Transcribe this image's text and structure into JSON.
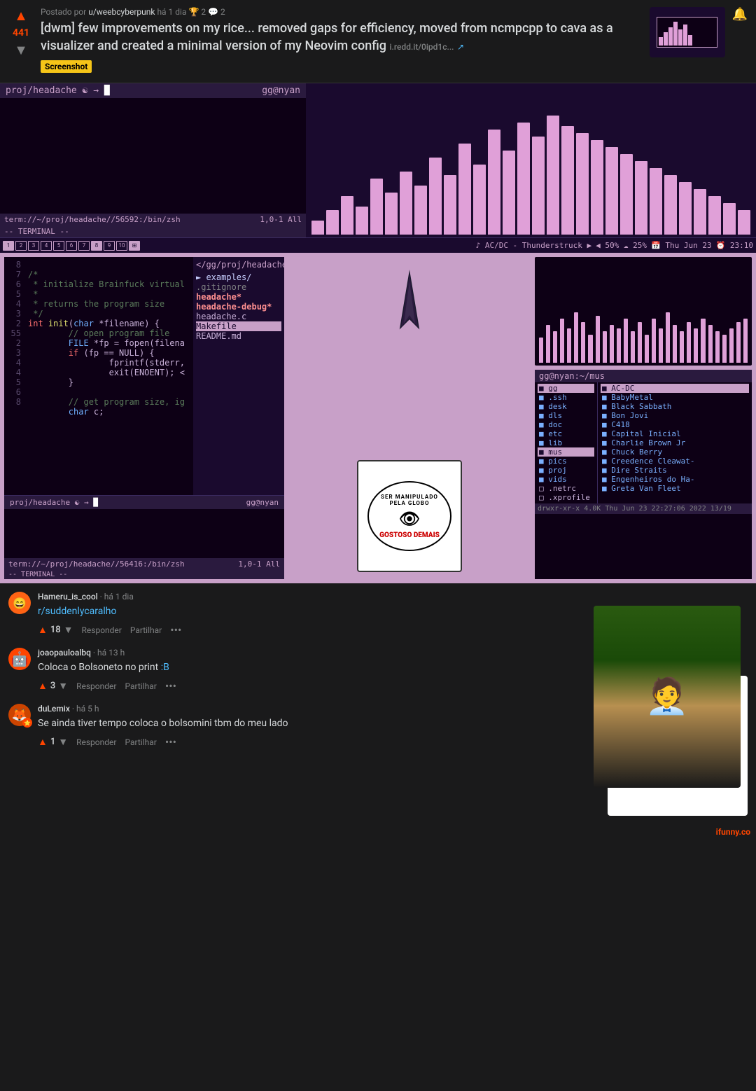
{
  "post": {
    "upvotes": "441",
    "username": "u/weebcyberpunk",
    "time": "há 1 dia",
    "comment_count": "2",
    "share_count": "2",
    "title": "[dwm] few improvements on my rice... removed gaps for efficiency, moved from ncmpcpp to cava as a visualizer and created a minimal version of my Neovim config",
    "link": "i.redd.it/0ipd1c...",
    "badge": "Screenshot"
  },
  "terminal": {
    "prompt": "proj/headache ☯ → ",
    "hostname": "gg@nyan",
    "path": "term://~/proj/headache//56592:/bin/zsh",
    "position": "1,0-1",
    "mode": "All",
    "status": "-- TERMINAL --"
  },
  "bars": {
    "heights": [
      20,
      35,
      55,
      40,
      80,
      60,
      90,
      70,
      110,
      85,
      130,
      100,
      150,
      120,
      160,
      140,
      170,
      155,
      145,
      135,
      125,
      115,
      105,
      95,
      85,
      75,
      65,
      55,
      45,
      35
    ],
    "mini_heights": [
      40,
      60,
      50,
      70,
      55,
      80,
      65,
      45,
      75,
      50,
      60,
      55,
      70,
      50,
      65,
      45,
      70,
      55,
      80,
      60,
      50,
      65,
      55,
      70,
      60,
      50,
      45,
      55,
      65,
      70
    ]
  },
  "bottom_bar": {
    "workspaces": [
      "1",
      "2",
      "3",
      "4",
      "5",
      "6",
      "7",
      "8",
      "9",
      "10"
    ],
    "music": "♪ AC/DC - Thunderstruck ▶",
    "volume": "◀ 50%  ☁ 25%",
    "date": "📅 Thu Jun 23",
    "time_display": "⏰ 23:10"
  },
  "code": {
    "lines": [
      {
        "num": "8",
        "content": "/*",
        "class": "code-comment"
      },
      {
        "num": "7",
        "content": " * initialize Brainfuck virtual",
        "class": "code-comment"
      },
      {
        "num": "6",
        "content": " *",
        "class": "code-comment"
      },
      {
        "num": "5",
        "content": " * returns the program size",
        "class": "code-comment"
      },
      {
        "num": "4",
        "content": " */",
        "class": "code-comment"
      },
      {
        "num": "3",
        "content": "int init(char *filename) {",
        "class": "code-keyword"
      },
      {
        "num": "2",
        "content": "    // open program file",
        "class": "code-comment"
      },
      {
        "num": "55",
        "content": "    FILE *fp = fopen(filena",
        "class": ""
      },
      {
        "num": "2",
        "content": "    if (fp == NULL) {",
        "class": ""
      },
      {
        "num": "3",
        "content": "        fprintf(stderr,",
        "class": ""
      },
      {
        "num": "4",
        "content": "        exit(ENOENT); <",
        "class": ""
      },
      {
        "num": "4",
        "content": "    }",
        "class": ""
      },
      {
        "num": "5",
        "content": "",
        "class": ""
      },
      {
        "num": "6",
        "content": "    // get program size, ig",
        "class": "code-comment"
      },
      {
        "num": "8",
        "content": "    char c;",
        "class": ""
      }
    ]
  },
  "file_manager": {
    "title_path": "</gg/proj/headache",
    "title_sub": "► examples/",
    "col1": [
      ".ssh",
      "desk",
      "dls",
      "doc",
      "etc",
      "lib",
      "mus",
      "pics",
      "proj",
      "vids",
      ".netrc",
      ".xprofile"
    ],
    "col1_selected": "mus",
    "col2": [
      "AC-DC",
      "BabyMetal",
      "Black Sabbath",
      "Bon Jovi",
      "C418",
      "Capital Inicial",
      "Charlie Brown Jr",
      "Chuck Berry",
      "Creedence Cleawat-",
      "Dire Straits",
      "Engenheiros do Ha-",
      "Greta Van Fleet"
    ],
    "col2_selected": "AC-DC",
    "statusbar": "drwxr-xr-x  4.0K  Thu Jun 23  22:27:06  2022      13/19",
    "files": [
      ".gitignore",
      "headache*",
      "headache-debug*",
      "headache.c",
      "Makefile",
      "README.md"
    ],
    "hostname": "gg@nyan:~/mus"
  },
  "terminal2": {
    "prompt": "proj/headache ☯ → ",
    "hostname": "gg@nyan",
    "path": "term://~/proj/headache//56416:/bin/zsh",
    "position": "1,0-1",
    "mode": "All",
    "status": "-- TERMINAL --"
  },
  "comments": [
    {
      "id": "comment1",
      "avatar_icon": "😄",
      "avatar_bg": "#ff6314",
      "author": "Hameru_is_cool",
      "time": "há 1 dia",
      "text": "r/suddenlycaralho",
      "is_link": true,
      "votes": "18",
      "actions": [
        "Responder",
        "Partilhar",
        "..."
      ]
    },
    {
      "id": "comment2",
      "avatar_icon": "🤖",
      "avatar_bg": "#ff4500",
      "author": "joaopauloalbq",
      "time": "há 13 h",
      "text": "Coloca o Bolsoneto no print ",
      "mention": ":B",
      "votes": "3",
      "actions": [
        "Responder",
        "Partilhar",
        "..."
      ]
    },
    {
      "id": "comment3",
      "avatar_icon": "🦊",
      "avatar_bg": "#cc4400",
      "author": "duLemix",
      "time": "há 5 h",
      "text": "Se ainda tiver tempo coloca o bolsomini tbm do meu lado",
      "votes": "1",
      "actions": [
        "Responder",
        "Partilhar",
        "..."
      ]
    }
  ],
  "watermark": "ifunny.co"
}
